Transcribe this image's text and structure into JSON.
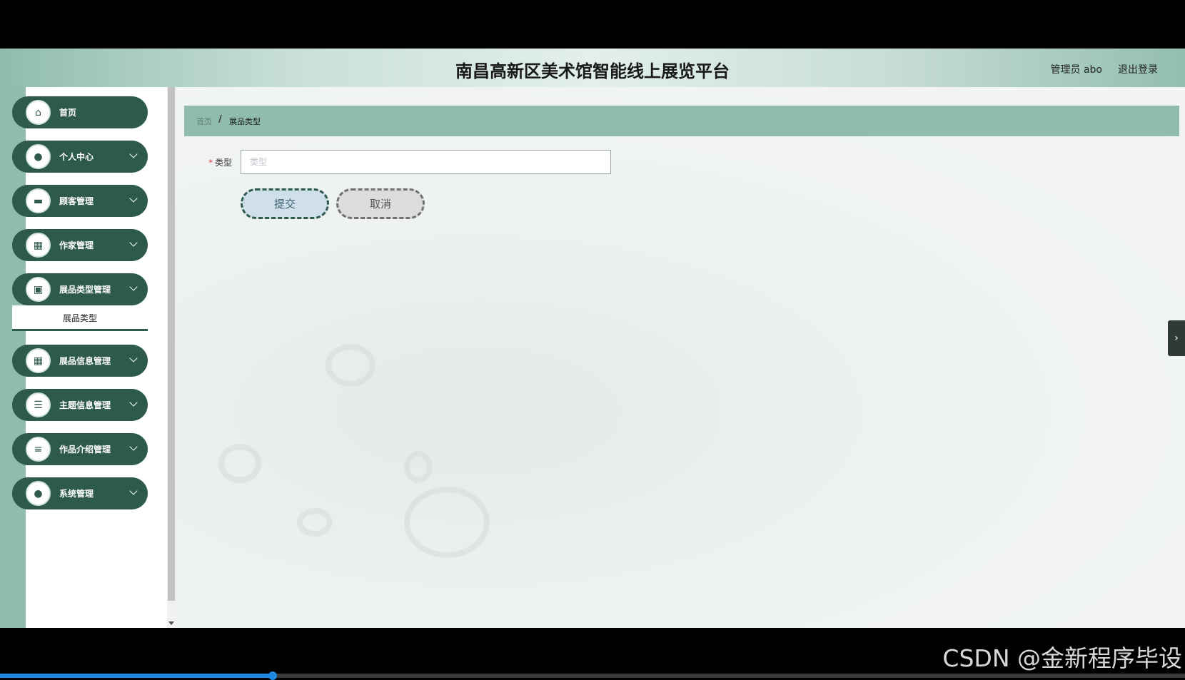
{
  "header": {
    "title": "南昌高新区美术馆智能线上展览平台",
    "user": "管理员 abo",
    "logout": "退出登录"
  },
  "sidebar": {
    "items": [
      {
        "label": "首页",
        "icon": "home-icon",
        "glyph": "⌂",
        "expandable": false
      },
      {
        "label": "个人中心",
        "icon": "user-icon",
        "glyph": "●",
        "expandable": true
      },
      {
        "label": "顾客管理",
        "icon": "monitor-icon",
        "glyph": "▬",
        "expandable": true
      },
      {
        "label": "作家管理",
        "icon": "grid-icon",
        "glyph": "▦",
        "expandable": true
      },
      {
        "label": "展品类型管理",
        "icon": "briefcase-icon",
        "glyph": "▣",
        "expandable": true
      },
      {
        "label": "展品信息管理",
        "icon": "grid-icon",
        "glyph": "▦",
        "expandable": true
      },
      {
        "label": "主题信息管理",
        "icon": "sliders-icon",
        "glyph": "☰",
        "expandable": true
      },
      {
        "label": "作品介绍管理",
        "icon": "list-icon",
        "glyph": "≡",
        "expandable": true
      },
      {
        "label": "系统管理",
        "icon": "user-icon",
        "glyph": "●",
        "expandable": true
      }
    ],
    "submenu_active": "展品类型"
  },
  "breadcrumb": {
    "home": "首页",
    "separator": "/",
    "current": "展品类型"
  },
  "form": {
    "type_label": "类型",
    "required_mark": "*",
    "type_placeholder": "类型",
    "type_value": "",
    "submit_label": "提交",
    "cancel_label": "取消"
  },
  "side_handle_glyph": "›",
  "watermark": "CSDN @金新程序毕设",
  "video_progress": 0.23,
  "colors": {
    "brand_dark": "#2d5a4b",
    "brand_light": "#8fbcae"
  }
}
